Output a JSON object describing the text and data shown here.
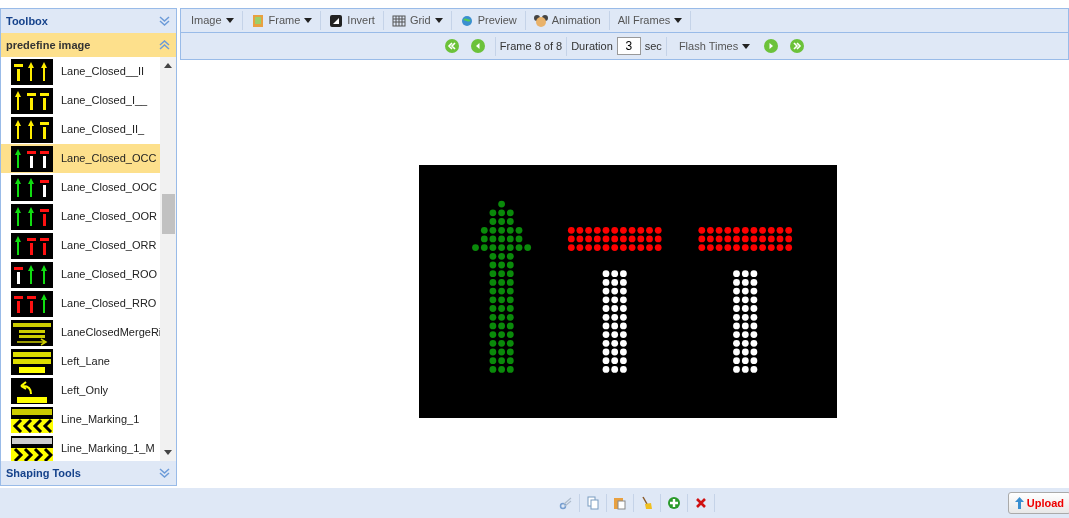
{
  "sidebar": {
    "title": "Toolbox",
    "sections": [
      {
        "title": "predefine image",
        "expanded": true,
        "items": [
          {
            "label": "Lane_Closed__II",
            "selected": false
          },
          {
            "label": "Lane_Closed_I__",
            "selected": false
          },
          {
            "label": "Lane_Closed_II_",
            "selected": false
          },
          {
            "label": "Lane_Closed_OCC",
            "selected": true
          },
          {
            "label": "Lane_Closed_OOC",
            "selected": false
          },
          {
            "label": "Lane_Closed_OOR",
            "selected": false
          },
          {
            "label": "Lane_Closed_ORR",
            "selected": false
          },
          {
            "label": "Lane_Closed_ROO",
            "selected": false
          },
          {
            "label": "Lane_Closed_RRO",
            "selected": false
          },
          {
            "label": "LaneClosedMergeRi",
            "selected": false
          },
          {
            "label": "Left_Lane",
            "selected": false
          },
          {
            "label": "Left_Only",
            "selected": false
          },
          {
            "label": "Line_Marking_1",
            "selected": false
          },
          {
            "label": "Line_Marking_1_M",
            "selected": false
          }
        ]
      },
      {
        "title": "Shaping Tools",
        "expanded": false
      }
    ]
  },
  "toolbar": [
    {
      "label": "Image",
      "dropdown": true
    },
    {
      "label": "Frame",
      "dropdown": true
    },
    {
      "label": "Invert",
      "dropdown": false
    },
    {
      "label": "Grid",
      "dropdown": true
    },
    {
      "label": "Preview",
      "dropdown": false
    },
    {
      "label": "Animation",
      "dropdown": false
    },
    {
      "label": "All Frames",
      "dropdown": true
    }
  ],
  "frame_bar": {
    "frame": "Frame 8 of 8",
    "duration_label": "Duration",
    "duration": "3",
    "unit": "sec",
    "flash": "Flash Times"
  },
  "bottom_tools": [
    {
      "disabled": true
    },
    {
      "disabled": false
    },
    {
      "disabled": false
    },
    {
      "disabled": false
    },
    {
      "disabled": false
    },
    {
      "disabled": false
    }
  ],
  "upload": "Upload"
}
